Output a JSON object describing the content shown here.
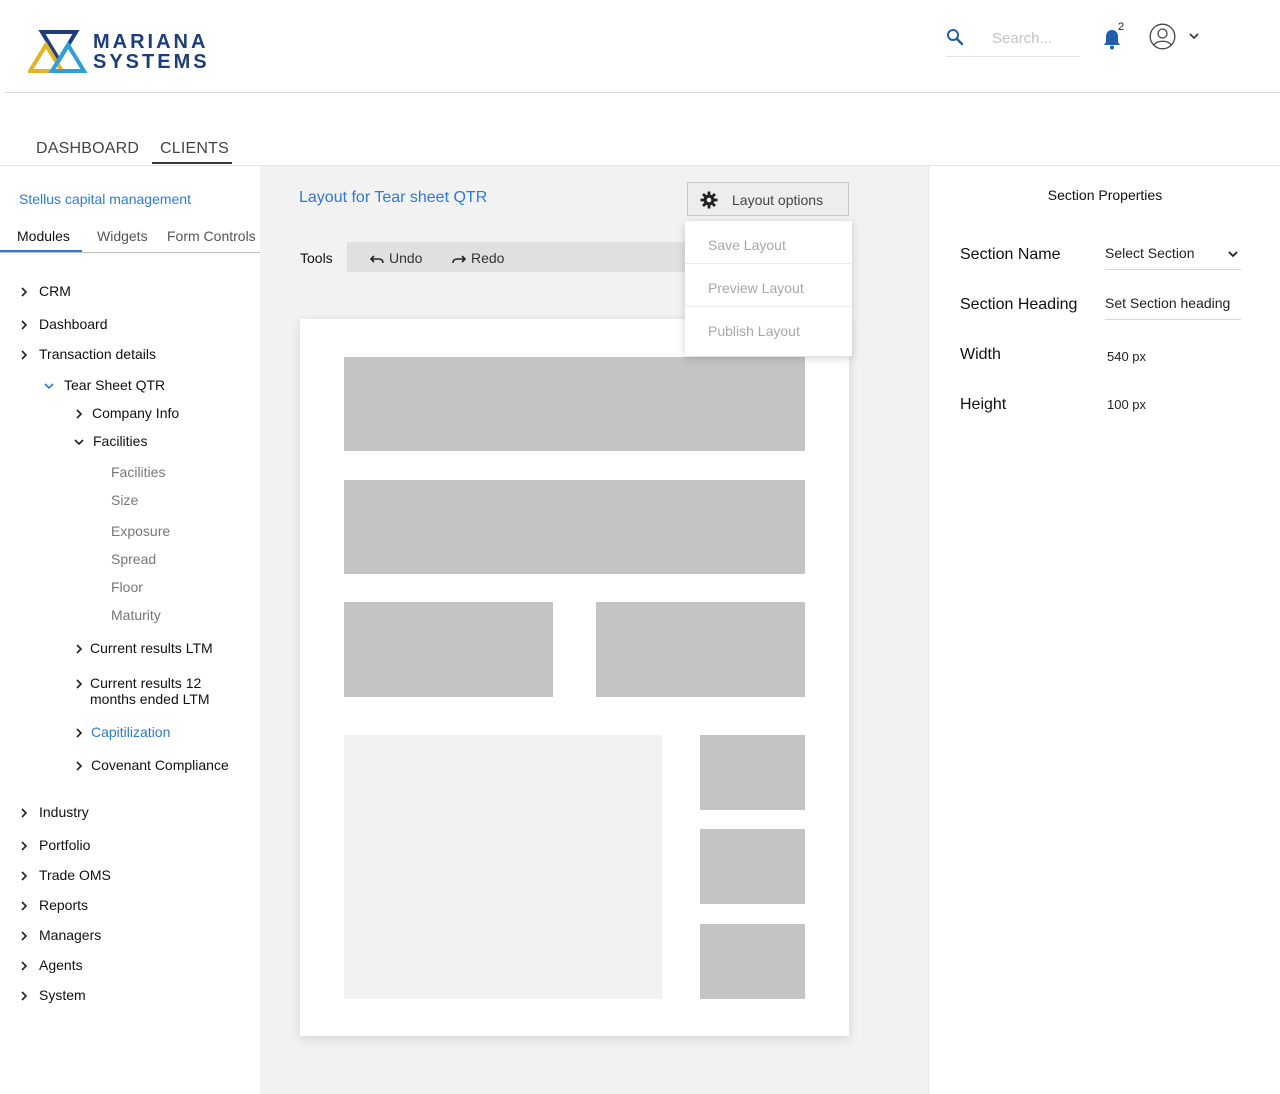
{
  "header": {
    "logo_line1": "MARIANA",
    "logo_line2": "SYSTEMS",
    "search_placeholder": "Search...",
    "notification_count": "2",
    "search_icon": "search-icon",
    "bell_icon": "bell-icon",
    "avatar_icon": "user-avatar-icon",
    "colors": {
      "brand_navy": "#1f3d7a",
      "brand_yellow": "#e2b324",
      "brand_blue": "#2e9fd8",
      "accent": "#2f7ad6"
    }
  },
  "topnav": {
    "tabs": [
      {
        "label": "DASHBOARD",
        "active": false
      },
      {
        "label": "CLIENTS",
        "active": true
      }
    ]
  },
  "sidebar": {
    "client_name": "Stellus capital management",
    "tabs": [
      {
        "label": "Modules",
        "active": true
      },
      {
        "label": "Widgets",
        "active": false
      },
      {
        "label": "Form Controls",
        "active": false
      }
    ],
    "tree": {
      "crm": "CRM",
      "dashboard": "Dashboard",
      "transaction_details": "Transaction details",
      "tear_sheet_qtr": "Tear Sheet QTR",
      "company_info": "Company Info",
      "facilities": "Facilities",
      "facilities_children": [
        "Facilities",
        "Size",
        "Exposure",
        "Spread",
        "Floor",
        "Maturity"
      ],
      "current_results_ltm": "Current results LTM",
      "current_results_12_line1": "Current results 12",
      "current_results_12_line2": "months ended LTM",
      "capitilization": "Capitilization",
      "covenant_compliance": "Covenant Compliance",
      "industry": "Industry",
      "portfolio": "Portfolio",
      "trade_oms": "Trade OMS",
      "reports": "Reports",
      "managers": "Managers",
      "agents": "Agents",
      "system": "System"
    }
  },
  "canvas": {
    "title": "Layout for Tear sheet QTR",
    "layout_options_label": "Layout options",
    "tools_label": "Tools",
    "undo_label": "Undo",
    "redo_label": "Redo",
    "dropdown_items": [
      "Save Layout",
      "Preview Layout",
      "Publish Layout"
    ]
  },
  "properties": {
    "title": "Section Properties",
    "section_name_label": "Section Name",
    "section_name_value": "Select Section",
    "section_heading_label": "Section Heading",
    "section_heading_placeholder": "Set Section heading",
    "width_label": "Width",
    "width_value": "540 px",
    "height_label": "Height",
    "height_value": "100 px"
  }
}
